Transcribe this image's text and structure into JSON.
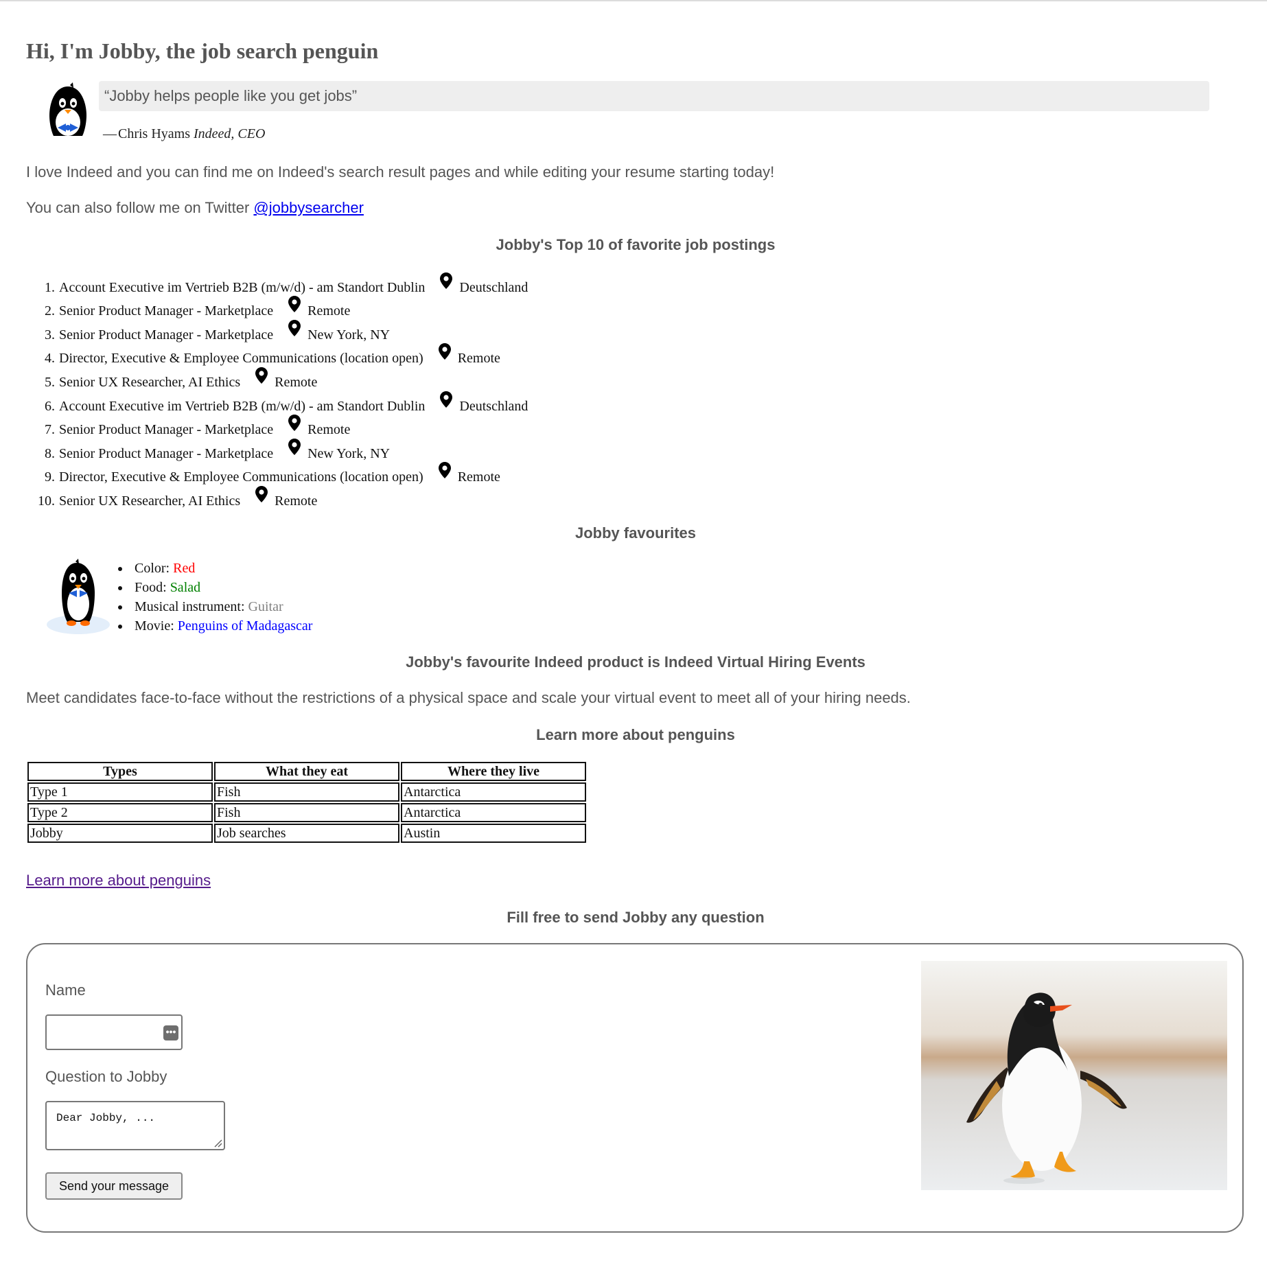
{
  "header": {
    "title": "Hi, I'm Jobby, the job search penguin"
  },
  "quote": {
    "text": "“Jobby helps people like you get jobs”",
    "dash": "—",
    "author": "Chris Hyams",
    "role": "Indeed, CEO"
  },
  "intro": {
    "text": "I love Indeed and you can find me on Indeed's search result pages and while editing your resume starting today!",
    "twitter_prefix": "You can also follow me on Twitter ",
    "twitter_handle": "@jobbysearcher"
  },
  "jobs_section": {
    "title": "Jobby's Top 10 of favorite job postings",
    "items": [
      {
        "num": "1.",
        "title": "Account Executive im Vertrieb B2B (m/w/d) - am Standort Dublin",
        "location": "Deutschland"
      },
      {
        "num": "2.",
        "title": "Senior Product Manager - Marketplace",
        "location": "Remote"
      },
      {
        "num": "3.",
        "title": "Senior Product Manager - Marketplace",
        "location": "New York, NY"
      },
      {
        "num": "4.",
        "title": "Director, Executive & Employee Communications (location open)",
        "location": "Remote"
      },
      {
        "num": "5.",
        "title": "Senior UX Researcher, AI Ethics",
        "location": "Remote"
      },
      {
        "num": "6.",
        "title": "Account Executive im Vertrieb B2B (m/w/d) - am Standort Dublin",
        "location": "Deutschland"
      },
      {
        "num": "7.",
        "title": "Senior Product Manager - Marketplace",
        "location": "Remote"
      },
      {
        "num": "8.",
        "title": "Senior Product Manager - Marketplace",
        "location": "New York, NY"
      },
      {
        "num": "9.",
        "title": "Director, Executive & Employee Communications (location open)",
        "location": "Remote"
      },
      {
        "num": "10.",
        "title": "Senior UX Researcher, AI Ethics",
        "location": "Remote"
      }
    ]
  },
  "favourites": {
    "title": "Jobby favourites",
    "items": [
      {
        "label": "Color: ",
        "value": "Red",
        "color": "#ff0000"
      },
      {
        "label": "Food: ",
        "value": "Salad",
        "color": "#008000"
      },
      {
        "label": "Musical instrument: ",
        "value": "Guitar",
        "color": "#808080"
      },
      {
        "label": "Movie: ",
        "value": "Penguins of Madagascar",
        "color": "#0000ff"
      }
    ]
  },
  "product": {
    "title": "Jobby's favourite Indeed product is Indeed Virtual Hiring Events",
    "description": "Meet candidates face-to-face without the restrictions of a physical space and scale your virtual event to meet all of your hiring needs."
  },
  "penguins": {
    "title": "Learn more about penguins",
    "headers": [
      "Types",
      "What they eat",
      "Where they live"
    ],
    "rows": [
      [
        "Type 1",
        "Fish",
        "Antarctica"
      ],
      [
        "Type 2",
        "Fish",
        "Antarctica"
      ],
      [
        "Jobby",
        "Job searches",
        "Austin"
      ]
    ],
    "link_text": "Learn more about penguins"
  },
  "contact": {
    "title": "Fill free to send Jobby any question",
    "name_label": "Name",
    "name_value": "",
    "question_label": "Question to Jobby",
    "question_value": "Dear Jobby, ...",
    "send_label": "Send your message"
  },
  "icons": {
    "avatar": "penguin-avatar-icon",
    "location": "map-pin-icon",
    "password_manager": "password-manager-icon"
  },
  "colors": {
    "text": "#555555",
    "link": "#0000ee",
    "visited_link": "#551a8b",
    "quote_background": "#eeeeee",
    "bowtie": "#1f5fd6"
  }
}
